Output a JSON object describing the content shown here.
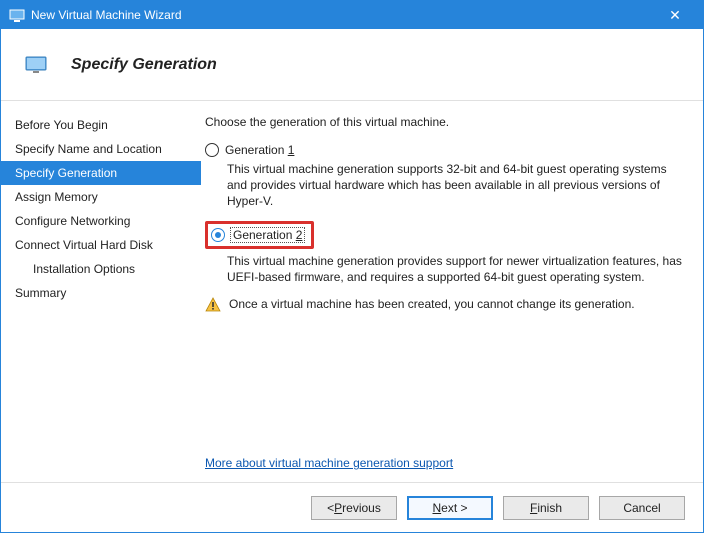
{
  "titlebar": {
    "title": "New Virtual Machine Wizard"
  },
  "header": {
    "title": "Specify Generation"
  },
  "sidebar": {
    "items": [
      {
        "label": "Before You Begin",
        "selected": false,
        "indent": false
      },
      {
        "label": "Specify Name and Location",
        "selected": false,
        "indent": false
      },
      {
        "label": "Specify Generation",
        "selected": true,
        "indent": false
      },
      {
        "label": "Assign Memory",
        "selected": false,
        "indent": false
      },
      {
        "label": "Configure Networking",
        "selected": false,
        "indent": false
      },
      {
        "label": "Connect Virtual Hard Disk",
        "selected": false,
        "indent": false
      },
      {
        "label": "Installation Options",
        "selected": false,
        "indent": true
      },
      {
        "label": "Summary",
        "selected": false,
        "indent": false
      }
    ]
  },
  "content": {
    "instruction": "Choose the generation of this virtual machine.",
    "gen1": {
      "label_pre": "Generation ",
      "label_ul": "1",
      "desc": "This virtual machine generation supports 32-bit and 64-bit guest operating systems and provides virtual hardware which has been available in all previous versions of Hyper-V."
    },
    "gen2": {
      "label_pre": "Generation ",
      "label_ul": "2",
      "desc": "This virtual machine generation provides support for newer virtualization features, has UEFI-based firmware, and requires a supported 64-bit guest operating system."
    },
    "warning": "Once a virtual machine has been created, you cannot change its generation.",
    "link": "More about virtual machine generation support"
  },
  "footer": {
    "previous_pre": "< ",
    "previous_ul": "P",
    "previous_post": "revious",
    "next_ul": "N",
    "next_post": "ext >",
    "finish_ul": "F",
    "finish_post": "inish",
    "cancel": "Cancel"
  }
}
